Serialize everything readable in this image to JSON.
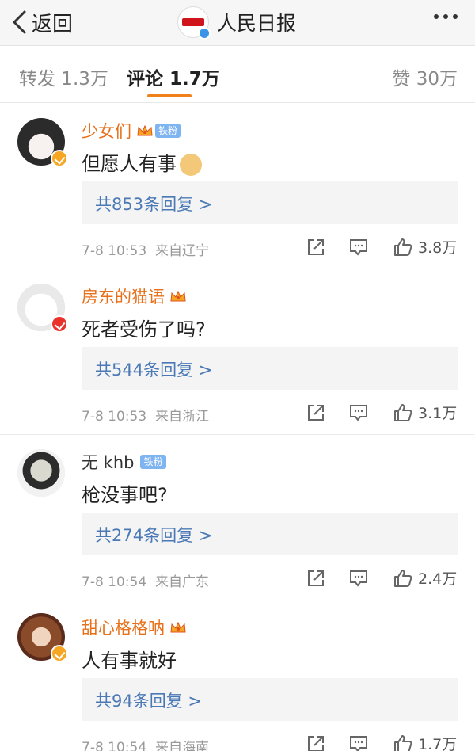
{
  "header": {
    "back_label": "返回",
    "title": "人民日报",
    "colors": {
      "accent": "#f0801a",
      "verified": "#3b94e6"
    }
  },
  "tabs": [
    {
      "label": "转发 1.3万"
    },
    {
      "label": "评论 1.7万",
      "active": true
    },
    {
      "label": "赞 30万"
    }
  ],
  "comments": [
    {
      "user": "少女们",
      "badge": "铁粉",
      "crown": true,
      "text": "但愿人有事",
      "emoji": "doge-emoji",
      "replies": "共853条回复 >",
      "time": "7-8 10:53",
      "location": "来自辽宁",
      "likes": "3.8万"
    },
    {
      "user": "房东的猫语",
      "crown": true,
      "text": "死者受伤了吗?",
      "replies": "共544条回复 >",
      "time": "7-8 10:53",
      "location": "来自浙江",
      "likes": "3.1万"
    },
    {
      "user": "无 khb",
      "badge": "铁粉",
      "text": "枪没事吧?",
      "replies": "共274条回复 >",
      "time": "7-8 10:54",
      "location": "来自广东",
      "likes": "2.4万"
    },
    {
      "user": "甜心格格呐",
      "crown": true,
      "text": "人有事就好",
      "replies": "共94条回复 >",
      "time": "7-8 10:54",
      "location": "来自海南",
      "likes": "1.7万"
    }
  ]
}
